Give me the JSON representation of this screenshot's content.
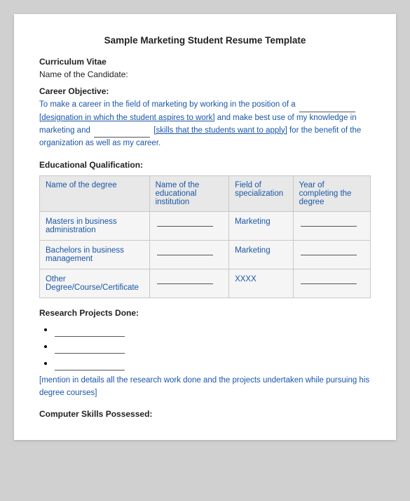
{
  "page": {
    "title": "Sample Marketing Student Resume Template",
    "cv_label": "Curriculum Vitae",
    "candidate_label": "Name of the Candidate:",
    "career_objective_label": "Career Objective:",
    "career_objective_text": "To make a career in the field of marketing by working in the position of a",
    "career_objective_blank1": "________________",
    "career_objective_bracket1": "[designation in which the student aspires to work]",
    "career_objective_mid": "and make best use of my knowledge in marketing and",
    "career_objective_blank2": "________________",
    "career_objective_bracket2": "[skills that the students want to apply]",
    "career_objective_end": "for the benefit of the organization as well as my career.",
    "ed_qual_label": "Educational Qualification:",
    "edu_table": {
      "headers": [
        "Name of the degree",
        "Name of the educational institution",
        "Field of specialization",
        "Year of completing the degree"
      ],
      "rows": [
        {
          "degree": "Masters in business administration",
          "institution": "________________",
          "field": "Marketing",
          "year": "________________"
        },
        {
          "degree": "Bachelors in business management",
          "institution": "________________",
          "field": "Marketing",
          "year": "________________"
        },
        {
          "degree": "Other Degree/Course/Certificate",
          "institution": "________________",
          "field": "XXXX",
          "year": "________________"
        }
      ]
    },
    "research_label": "Research Projects Done:",
    "research_bullets": [
      "________________",
      "________________",
      "________________"
    ],
    "research_note": "[mention in details all the research work done and the projects undertaken while pursuing his degree courses]",
    "computer_skills_label": "Computer Skills Possessed:"
  }
}
